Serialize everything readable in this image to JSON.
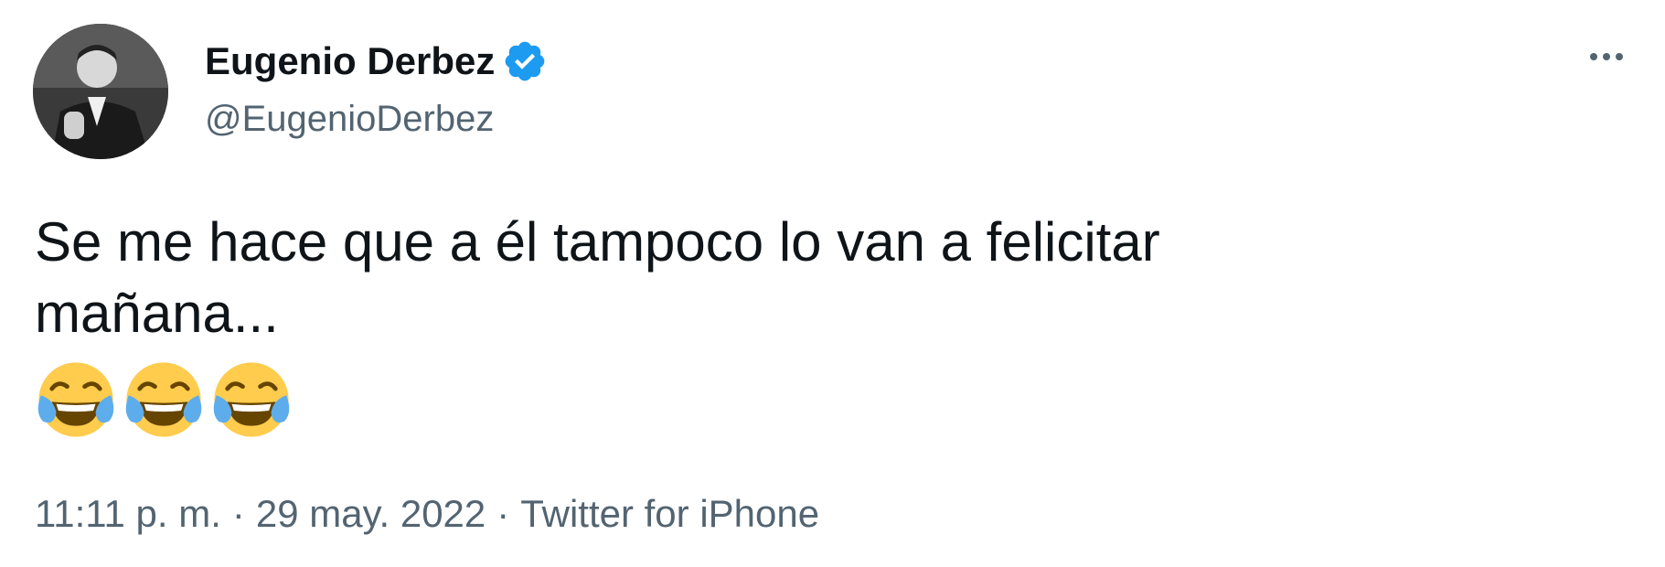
{
  "author": {
    "display_name": "Eugenio Derbez",
    "handle": "@EugenioDerbez",
    "verified": true
  },
  "tweet": {
    "text_line1": "Se me hace que a él tampoco lo van a felicitar",
    "text_line2": "mañana...",
    "emojis": [
      "face-with-tears-of-joy",
      "face-with-tears-of-joy",
      "face-with-tears-of-joy"
    ]
  },
  "meta": {
    "time": "11:11 p. m.",
    "separator": "·",
    "date": "29 may. 2022",
    "source": "Twitter for iPhone"
  },
  "colors": {
    "text": "#0f1419",
    "secondary": "#536471",
    "verified_blue": "#1d9bf0"
  },
  "icons": {
    "more": "more-options-icon",
    "verified": "verified-badge-icon"
  }
}
